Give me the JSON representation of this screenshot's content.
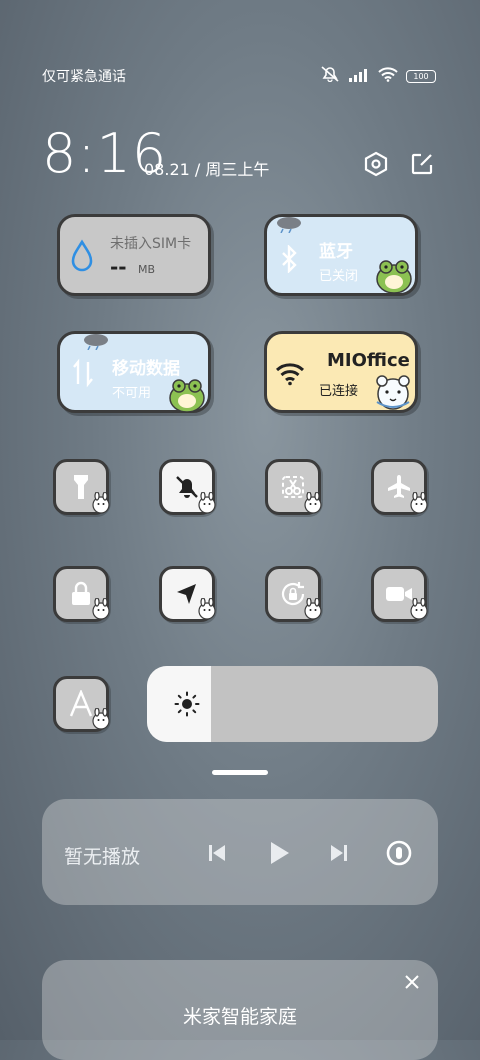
{
  "status_bar": {
    "carrier_text": "仅可紧急通话",
    "battery_level": "100"
  },
  "header": {
    "time": "8:16",
    "date": "08.21 / 周三上午"
  },
  "tiles": {
    "data_usage": {
      "label": "未插入SIM卡",
      "value": "--",
      "unit": "MB"
    },
    "bluetooth": {
      "label": "蓝牙",
      "status": "已关闭"
    },
    "mobile_data": {
      "label": "移动数据",
      "status": "不可用"
    },
    "wifi": {
      "label": "MIOffice",
      "status": "已连接"
    }
  },
  "brightness": {
    "level": 0.22
  },
  "media": {
    "text": "暂无播放"
  },
  "smart_home": {
    "title": "米家智能家庭"
  },
  "colors": {
    "accent_blue": "#2f8fe3",
    "tile_blue": "#d6e8f6",
    "tile_yellow": "#fbe9b4",
    "tile_gray": "#c8c8c8"
  }
}
